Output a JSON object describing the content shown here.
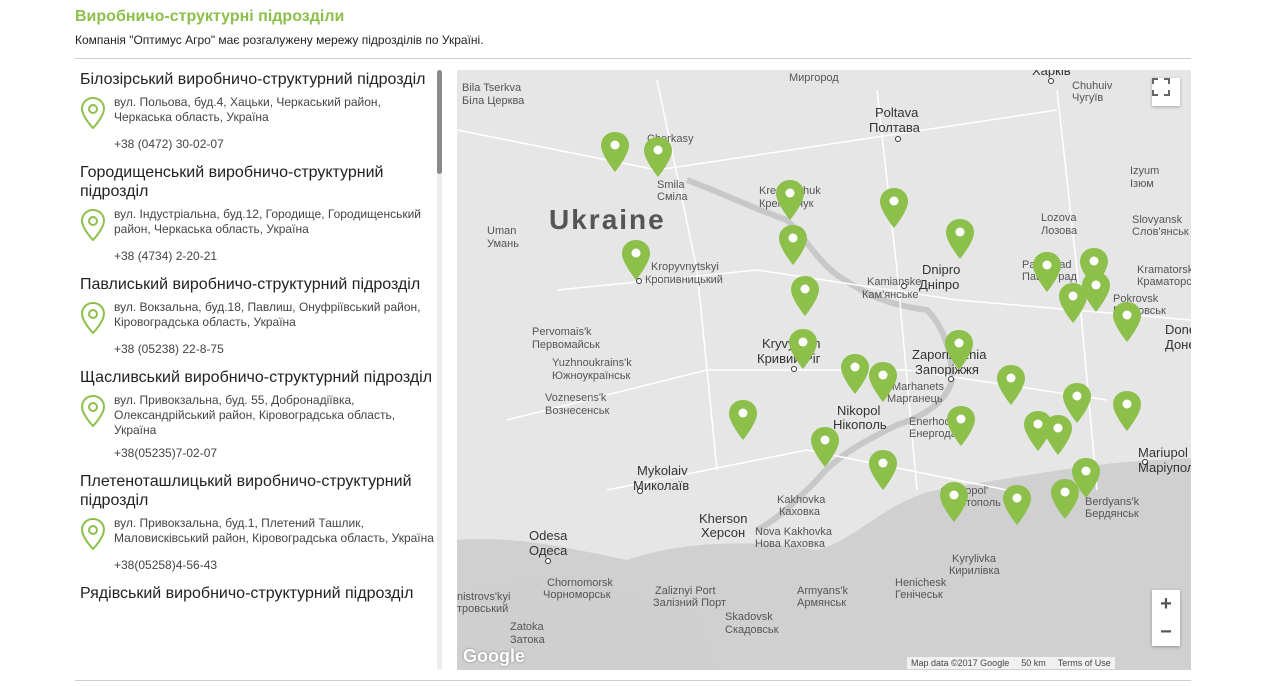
{
  "header": {
    "title": "Виробничо-структурні підрозділи",
    "subtitle": "Компанія \"Оптимус Агро\" має розгалужену мережу підрозділів по Україні."
  },
  "divisions": [
    {
      "name": "Білозірський виробничо-структурний підрозділ",
      "address": "вул. Польова, буд.4, Хацьки, Черкаський район, Черкаська область, Україна",
      "phone": "+38 (0472) 30-02-07"
    },
    {
      "name": "Городищенський виробничо-структурний підрозділ",
      "address": "вул. Індустріальна, буд.12, Городище, Городищенський район, Черкаська область, Україна",
      "phone": "+38 (4734) 2-20-21"
    },
    {
      "name": "Павлиський виробничо-структурний підрозділ",
      "address": "вул. Вокзальна, буд.18, Павлиш, Онуфріївський район, Кіровоградська область, Україна",
      "phone": "+38 (05238) 22-8-75"
    },
    {
      "name": "Щасливський виробничо-структурний підрозділ",
      "address": "вул. Привокзальна, буд. 55, Добронадіївка, Олександрійський район, Кіровоградська область, Україна",
      "phone": "+38(05235)7-02-07"
    },
    {
      "name": "Плетеноташлицький виробничо-структурний підрозділ",
      "address": "вул. Привокзальна, буд.1, Плетений Ташлик, Маловисківський район, Кіровоградська область, Україна",
      "phone": "+38(05258)4-56-43"
    },
    {
      "name": "Рядівський виробничо-структурний підрозділ",
      "address": "",
      "phone": ""
    }
  ],
  "map": {
    "country_label": "Ukraine",
    "labels": {
      "bila_tserkva": "Bila Tserkva",
      "bila_tserkva_uk": "Біла Церква",
      "cherkasy": "Cherkasy",
      "smila": "Smila",
      "smila_uk": "Сміла",
      "kremenchuk": "Kremenchuk",
      "kremenchuk_uk": "Кременчук",
      "poltava": "Poltava",
      "poltava_uk": "Полтава",
      "kharkiv_uk": "Харків",
      "chuhuiv": "Chuhuiv",
      "chuhuiv_uk": "Чугуїв",
      "izyum": "Izyum",
      "izyum_uk": "Ізюм",
      "myrhorod_uk": "Миргород",
      "kropyvnytskyi": "Kropyvnytskyi",
      "kropyvnytskyi_uk": "Кропивницький",
      "kamianske": "Kamianske",
      "kamianske_uk": "Кам'янське",
      "dnipro": "Dnipro",
      "dnipro_uk": "Дніпро",
      "pavlohrad": "Pavlohrad",
      "pavlohrad_uk": "Павлоград",
      "lozova": "Lozova",
      "lozova_uk": "Лозова",
      "sloviansk": "Slovyansk",
      "sloviansk_uk": "Слов'янськ",
      "kramatorsk": "Kramatorsk",
      "kramatorsk_uk": "Краматорськ",
      "pokrovsk": "Pokrovsk",
      "pokrovsk_uk": "Покровськ",
      "donetsk": "Donetsk",
      "donetsk_uk": "Донецьк",
      "uman": "Uman",
      "uman_uk": "Умань",
      "pervomaisk": "Pervomais'k",
      "pervomaisk_uk": "Первомайськ",
      "yuzhnoukrainsk": "Yuzhnoukrains'k",
      "yuzhnoukrainsk_uk": "Южноукраїнськ",
      "voznesensk": "Voznesens'k",
      "voznesensk_uk": "Вознесенськ",
      "kryvyi_rih": "Kryvyi Rih",
      "kryvyi_rih_uk": "Кривий Ріг",
      "zaporizhzhia": "Zaporizhzhia",
      "zaporizhzhia_uk": "Запоріжжя",
      "marhanets": "Marhanets",
      "marhanets_uk": "Марганець",
      "nikopol": "Nikopol",
      "nikopol_uk": "Нікополь",
      "enerhodar": "Enerhodar",
      "enerhodar_uk": "Енергодар",
      "mykolaiv": "Mykolaiv",
      "mykolaiv_uk": "Миколаїв",
      "kakhovka": "Kakhovka",
      "kakhovka_uk": "Каховка",
      "kherson": "Kherson",
      "kherson_uk": "Херсон",
      "nova_kakhovka": "Nova Kakhovka",
      "nova_kakhovka_uk": "Нова Каховка",
      "odesa": "Odesa",
      "odesa_uk": "Одеса",
      "melitopol": "Melitopol'",
      "melitopol_uk": "Мелітополь",
      "berdyansk": "Berdyans'k",
      "berdyansk_uk": "Бердянськ",
      "mariupol": "Mariupol",
      "mariupol_uk": "Маріуполь",
      "chornomorsk": "Chornomorsk",
      "chornomorsk_uk": "Чорноморськ",
      "zaliznyi_port": "Zaliznyi Port",
      "zaliznyi_port_uk": "Залізний Порт",
      "henichesk": "Henichesk",
      "henichesk_uk": "Генічеськ",
      "kyrylivka": "Kyrylivka",
      "kyrylivka_uk": "Кирилівка",
      "armiansk": "Armyans'k",
      "armiansk_uk": "Армянськ",
      "skadovsk": "Skadovsk",
      "skadovsk_uk": "Скадовськ",
      "zatoka": "Zatoka",
      "zatoka_uk": "Затока",
      "bilhorod": "nistrovs'kyi",
      "bilhorod_uk": "тровський"
    },
    "zoom_in": "+",
    "zoom_out": "−",
    "logo": "Google",
    "attribution": "Map data ©2017 Google",
    "scale": "50 km",
    "terms": "Terms of Use",
    "pin_color": "#8cc04b"
  }
}
